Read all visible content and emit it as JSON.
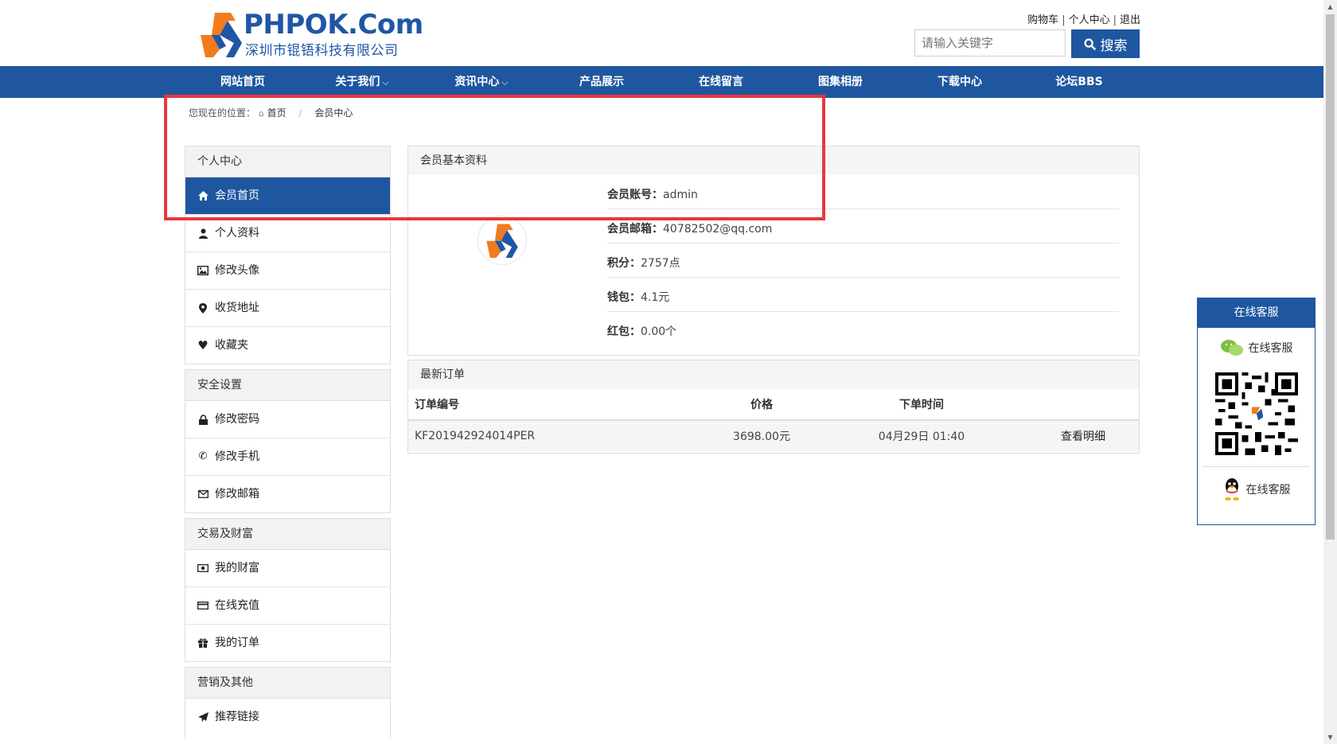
{
  "header": {
    "logo_text_en": "PHPOK.Com",
    "logo_text_cn": "深圳市锟铻科技有限公司",
    "top_links": [
      "购物车",
      "个人中心",
      "退出"
    ],
    "search": {
      "placeholder": "请输入关键字",
      "button_label": "搜索"
    }
  },
  "nav": {
    "items": [
      {
        "label": "网站首页",
        "has_dropdown": false
      },
      {
        "label": "关于我们",
        "has_dropdown": true
      },
      {
        "label": "资讯中心",
        "has_dropdown": true
      },
      {
        "label": "产品展示",
        "has_dropdown": false
      },
      {
        "label": "在线留言",
        "has_dropdown": false
      },
      {
        "label": "图集相册",
        "has_dropdown": false
      },
      {
        "label": "下载中心",
        "has_dropdown": false
      },
      {
        "label": "论坛BBS",
        "has_dropdown": false
      }
    ]
  },
  "breadcrumb": {
    "prefix": "您现在的位置：",
    "home": "首页",
    "divider": "/",
    "current": "会员中心"
  },
  "sidebar": {
    "groups": [
      {
        "title": "个人中心",
        "items": [
          {
            "label": "会员首页",
            "icon": "home-icon",
            "active": true
          },
          {
            "label": "个人资料",
            "icon": "user-icon"
          },
          {
            "label": "修改头像",
            "icon": "image-icon"
          },
          {
            "label": "收货地址",
            "icon": "map-marker-icon"
          },
          {
            "label": "收藏夹",
            "icon": "heart-icon"
          }
        ]
      },
      {
        "title": "安全设置",
        "items": [
          {
            "label": "修改密码",
            "icon": "lock-icon"
          },
          {
            "label": "修改手机",
            "icon": "phone-icon"
          },
          {
            "label": "修改邮箱",
            "icon": "envelope-icon"
          }
        ]
      },
      {
        "title": "交易及财富",
        "items": [
          {
            "label": "我的财富",
            "icon": "money-icon"
          },
          {
            "label": "在线充值",
            "icon": "credit-card-icon"
          },
          {
            "label": "我的订单",
            "icon": "gift-icon"
          }
        ]
      },
      {
        "title": "营销及其他",
        "items": [
          {
            "label": "推荐链接",
            "icon": "send-icon"
          }
        ]
      }
    ]
  },
  "profile": {
    "title": "会员基本资料",
    "fields": [
      {
        "key": "会员账号：",
        "value": "admin"
      },
      {
        "key": "会员邮箱：",
        "value": "40782502@qq.com"
      },
      {
        "key": "积分：",
        "value": "2757点"
      },
      {
        "key": "钱包：",
        "value": "4.1元"
      },
      {
        "key": "红包：",
        "value": "0.00个"
      }
    ]
  },
  "orders": {
    "title": "最新订单",
    "columns": [
      "订单编号",
      "价格",
      "下单时间",
      ""
    ],
    "rows": [
      {
        "id": "KF201942924014PER",
        "price": "3698.00元",
        "time": "04月29日 01:40",
        "action": "查看明细"
      }
    ]
  },
  "service": {
    "title": "在线客服",
    "wechat_label": "在线客服",
    "qq_label": "在线客服"
  },
  "colors": {
    "primary": "#1f56a0",
    "logo_orange": "#f07c1e",
    "highlight": "#e8383d"
  }
}
